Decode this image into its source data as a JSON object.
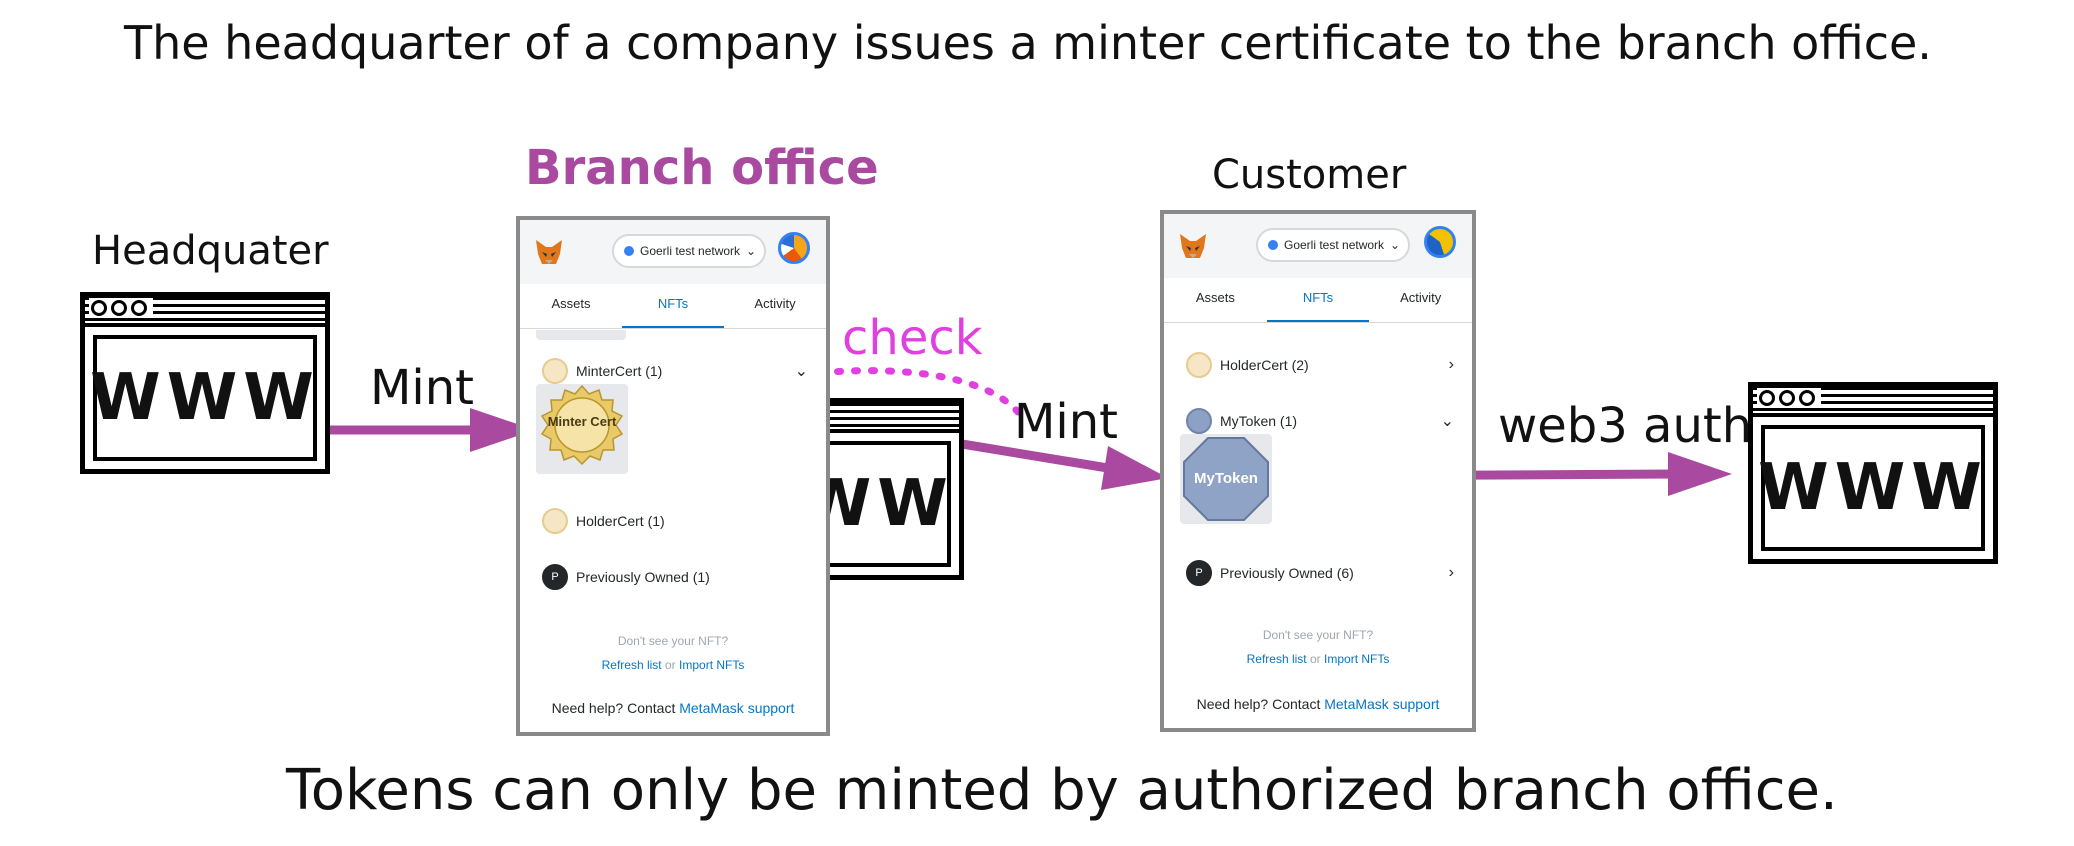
{
  "captions": {
    "top": "The headquarter of a company issues a minter certificate to the branch office.",
    "bottom": "Tokens can only be minted by authorized branch office."
  },
  "nodes": {
    "headquarter": "Headquater",
    "branch": "Branch office",
    "customer": "Customer"
  },
  "edges": {
    "mint1": "Mint",
    "check": "check",
    "mint2": "Mint",
    "web3auth": "web3 auth"
  },
  "browser_icon_text": "WWW",
  "colors": {
    "arrow": "#a94aa0",
    "check": "#e040e0",
    "branch_title": "#a94aa0",
    "link": "#0376c9"
  },
  "branch_panel": {
    "network": "Goerli test network",
    "tabs": [
      "Assets",
      "NFTs",
      "Activity"
    ],
    "rows": {
      "minter": "MinterCert (1)",
      "holder": "HolderCert (1)",
      "prev": "Previously Owned (1)"
    },
    "minter_nft": "Minter Cert",
    "prev_badge": "P",
    "no_nft": "Don't see your NFT?",
    "refresh": "Refresh list",
    "or": "or",
    "import": "Import NFTs",
    "help": "Need help? Contact",
    "support": "MetaMask support"
  },
  "customer_panel": {
    "network": "Goerli test network",
    "tabs": [
      "Assets",
      "NFTs",
      "Activity"
    ],
    "rows": {
      "holder": "HolderCert (2)",
      "mytoken": "MyToken (1)",
      "prev": "Previously Owned (6)"
    },
    "token_nft": "MyToken",
    "prev_badge": "P",
    "no_nft": "Don't see your NFT?",
    "refresh": "Refresh list",
    "or": "or",
    "import": "Import NFTs",
    "help": "Need help? Contact",
    "support": "MetaMask support"
  }
}
